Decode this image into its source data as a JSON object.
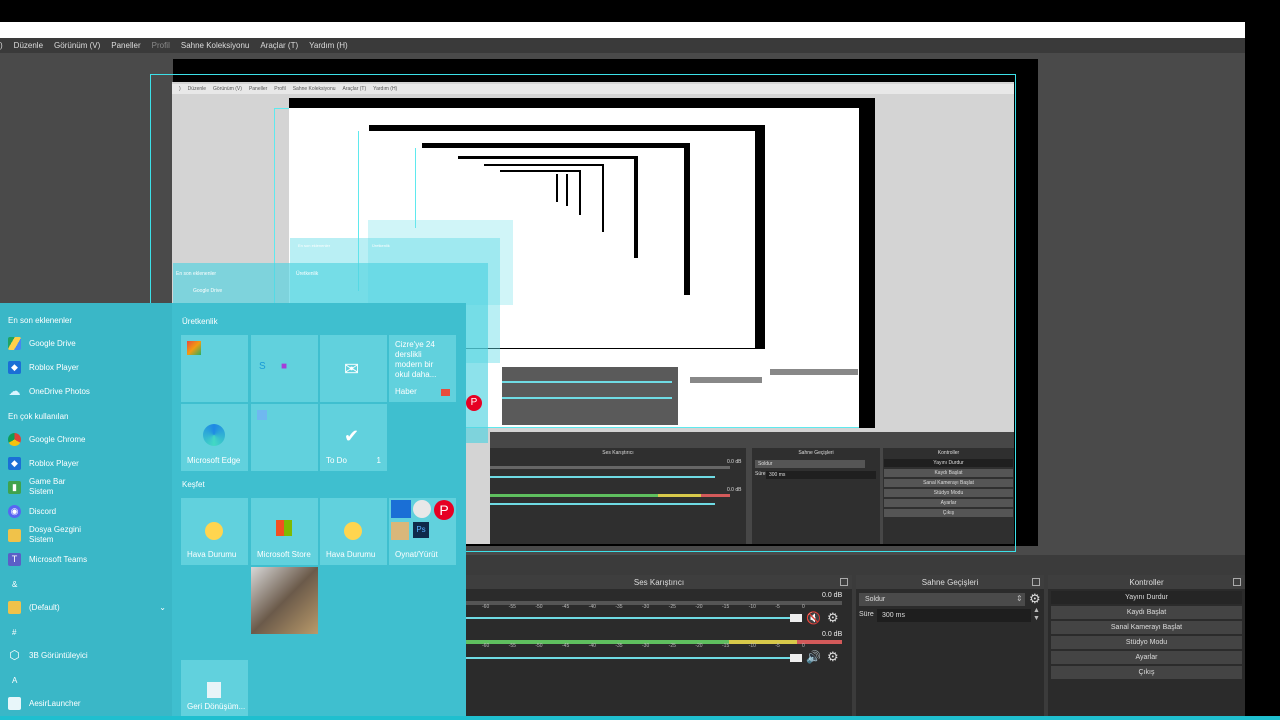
{
  "menubar": {
    "items": [
      {
        "label": ")",
        "dim": false
      },
      {
        "label": "Düzenle",
        "dim": false
      },
      {
        "label": "Görünüm (V)",
        "dim": false
      },
      {
        "label": "Paneller",
        "dim": false
      },
      {
        "label": "Profil",
        "dim": true
      },
      {
        "label": "Sahne Koleksiyonu",
        "dim": false
      },
      {
        "label": "Araçlar (T)",
        "dim": false
      },
      {
        "label": "Yardım (H)",
        "dim": false
      }
    ]
  },
  "inner_menubar": {
    "items": [
      ")",
      "Düzenle",
      "Görünüm (V)",
      "Paneller",
      "Profil",
      "Sahne Koleksiyonu",
      "Araçlar (T)",
      "Yardım (H)"
    ]
  },
  "inner_docks": {
    "audio_title": "Ses Karıştırıcı",
    "transitions_title": "Sahne Geçişleri",
    "controls_title": "Kontroller",
    "db1": "0.0 dB",
    "db2": "0.0 dB",
    "transition": "Soldur",
    "duration_label": "Süre",
    "duration": "300 ms",
    "buttons": [
      "Yayını Durdur",
      "Kaydı Başlat",
      "Sanal Kamerayı Başlat",
      "Stüdyo Modu",
      "Ayarlar",
      "Çıkış"
    ]
  },
  "audio_mixer": {
    "title": "Ses Karıştırıcı",
    "track1": {
      "db": "0.0 dB"
    },
    "track2": {
      "db": "0.0 dB"
    },
    "ticks": [
      "-60",
      "-55",
      "-50",
      "-45",
      "-40",
      "-35",
      "-30",
      "-25",
      "-20",
      "-15",
      "-10",
      "-5",
      "0"
    ]
  },
  "scene_transitions": {
    "title": "Sahne Geçişleri",
    "transition": "Soldur",
    "duration_label": "Süre",
    "duration": "300 ms"
  },
  "controls": {
    "title": "Kontroller",
    "buttons": [
      "Yayını Durdur",
      "Kaydı Başlat",
      "Sanal Kamerayı Başlat",
      "Stüdyo Modu",
      "Ayarlar",
      "Çıkış"
    ]
  },
  "start_menu": {
    "recent_header": "En son eklenenler",
    "recent": [
      "Google Drive",
      "Roblox Player",
      "OneDrive Photos"
    ],
    "most_used_header": "En çok kullanılan",
    "most_used": [
      {
        "label": "Google Chrome",
        "sub": ""
      },
      {
        "label": "Roblox Player",
        "sub": ""
      },
      {
        "label": "Game Bar",
        "sub": "Sistem"
      },
      {
        "label": "Discord",
        "sub": ""
      },
      {
        "label": "Dosya Gezgini",
        "sub": "Sistem"
      },
      {
        "label": "Microsoft Teams",
        "sub": ""
      }
    ],
    "letter_amp": "&",
    "default_folder": "(Default)",
    "letter_hash": "#",
    "viewer": "3B Görüntüleyici",
    "letter_a": "A",
    "aesir": "AesirLauncher",
    "productivity_header": "Üretkenlik",
    "explore_header": "Keşfet",
    "news_text": "Cizre'ye 24 derslikli modern bir okul daha...",
    "news_source": "Haber",
    "tiles": {
      "edge": "Microsoft Edge",
      "todo": "To Do",
      "todo_count": "1",
      "weather1": "Hava Durumu",
      "store": "Microsoft Store",
      "weather2": "Hava Durumu",
      "play": "Oynat/Yürüt",
      "recycle": "Geri Dönüşüm..."
    }
  },
  "colors": {
    "accent_cyan": "#3ce0e8",
    "start_menu_bg": "#3fbfcf",
    "obs_dark": "#2b2b2b",
    "mute_red": "#c0392b"
  }
}
